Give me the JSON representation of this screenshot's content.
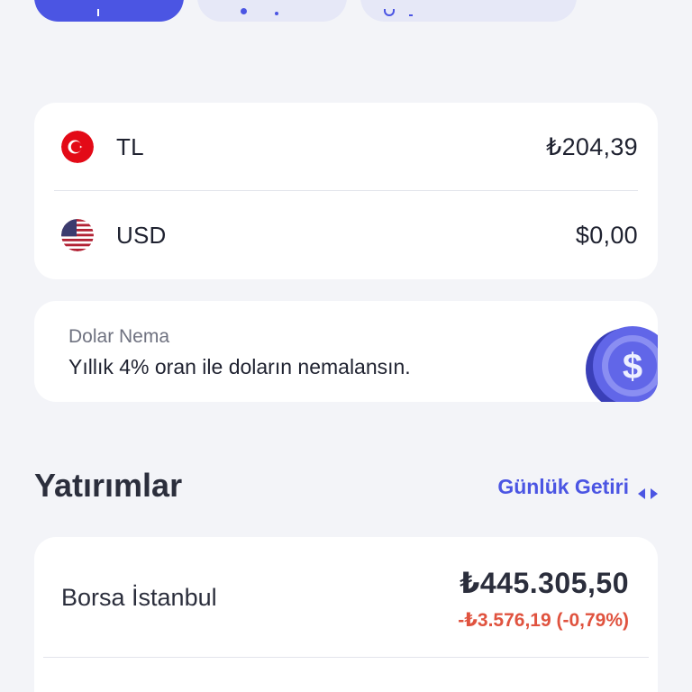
{
  "balances": [
    {
      "currency": "TL",
      "amount": "₺204,39",
      "flag_icon": "turkey-flag-icon"
    },
    {
      "currency": "USD",
      "amount": "$0,00",
      "flag_icon": "usa-flag-icon"
    }
  ],
  "promo": {
    "title": "Dolar Nema",
    "text": "Yıllık 4% oran ile doların nemalansın.",
    "icon": "dollar-coin-icon"
  },
  "investments_section": {
    "title": "Yatırımlar",
    "toggle_label": "Günlük Getiri",
    "toggle_icon": "left-right-arrows-icon"
  },
  "investments": [
    {
      "name": "Borsa İstanbul",
      "value": "₺445.305,50",
      "change": "-₺3.576,19 (-0,79%)"
    }
  ],
  "colors": {
    "accent": "#4b55e3",
    "negative": "#e0533f",
    "background": "#f3f4f8"
  }
}
